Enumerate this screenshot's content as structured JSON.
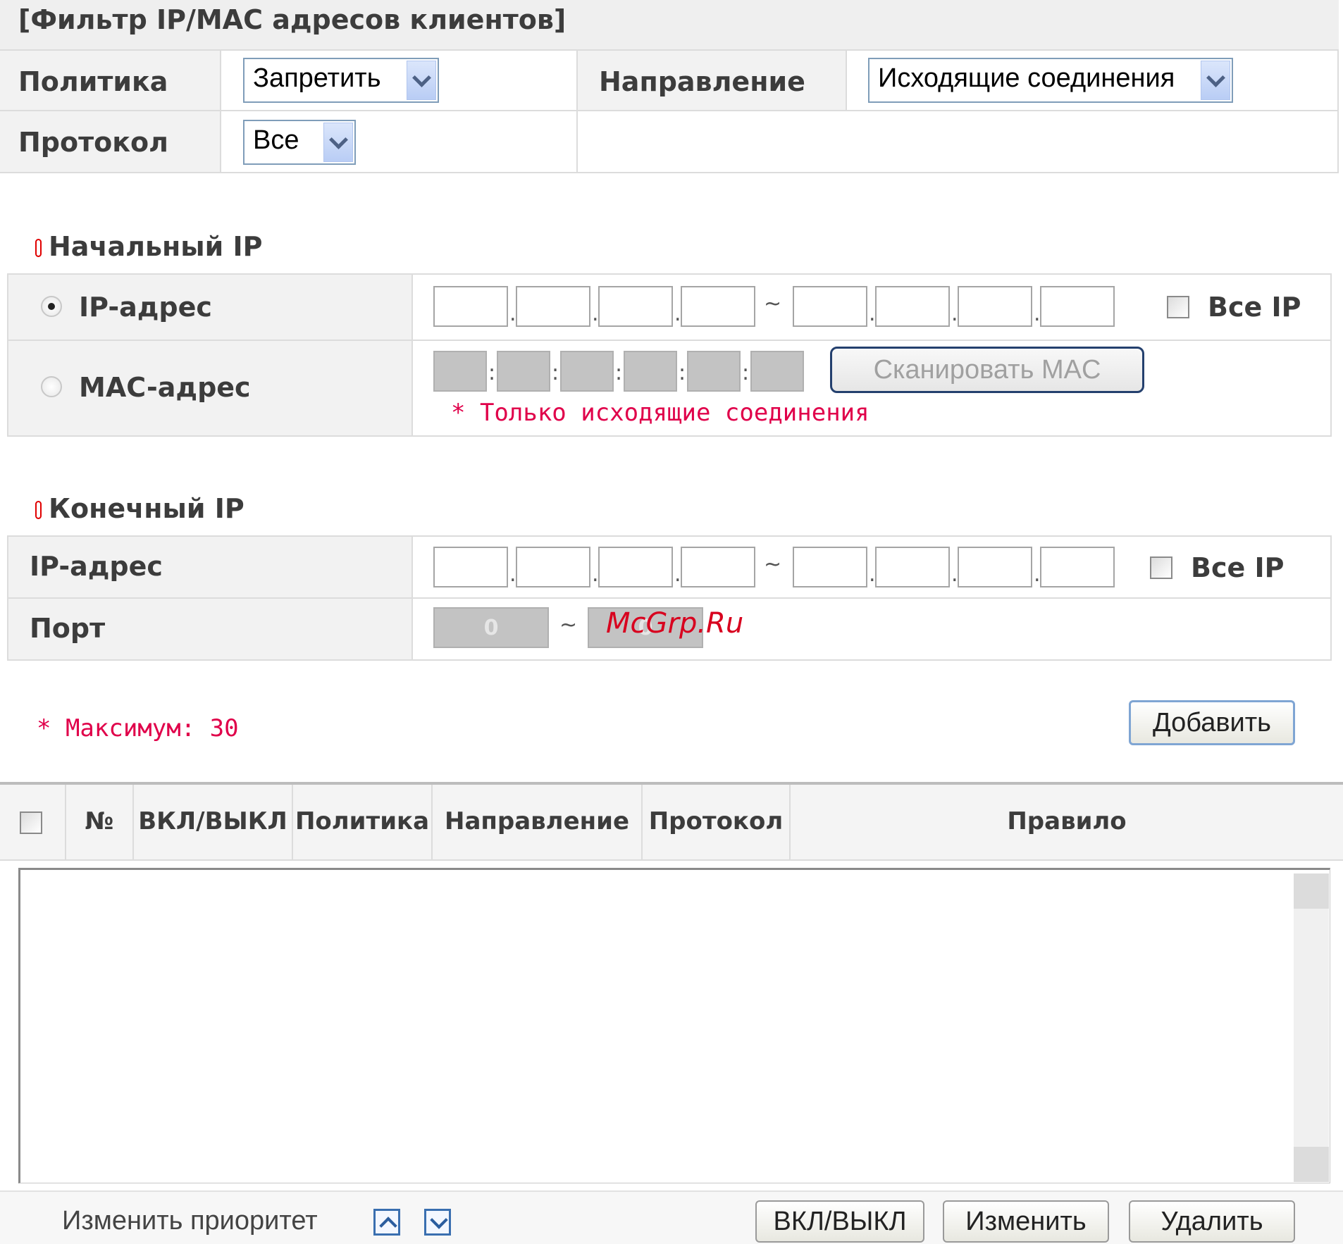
{
  "filter": {
    "title": "[Фильтр IP/MAC адресов клиентов]",
    "policy_label": "Политика",
    "policy_value": "Запретить",
    "direction_label": "Направление",
    "direction_value": "Исходящие соединения",
    "protocol_label": "Протокол",
    "protocol_value": "Все"
  },
  "source": {
    "header": "Начальный IP",
    "ip_label": "IP-адрес",
    "mac_label": "MAC-адрес",
    "all_ip_label": "Все IP",
    "scan_mac_label": "Сканировать MAC",
    "note": "* Только исходящие соединения",
    "range_separator": "~"
  },
  "destination": {
    "header": "Конечный IP",
    "ip_label": "IP-адрес",
    "port_label": "Порт",
    "all_ip_label": "Все IP",
    "port_from": "0",
    "port_to": "0",
    "range_separator": "~"
  },
  "add": {
    "max_note": "* Максимум: 30",
    "add_label": "Добавить"
  },
  "list": {
    "columns": [
      "№",
      "ВКЛ/ВЫКЛ",
      "Политика",
      "Направление",
      "Протокол",
      "Правило"
    ],
    "rows": []
  },
  "footer": {
    "priority_label": "Изменить приоритет",
    "toggle_label": "ВКЛ/ВЫКЛ",
    "edit_label": "Изменить",
    "delete_label": "Удалить"
  },
  "watermark": "McGrp.Ru",
  "colors": {
    "accent_red": "#e0004a",
    "label_bg": "#f2f2f2",
    "select_border": "#7f9db9"
  }
}
